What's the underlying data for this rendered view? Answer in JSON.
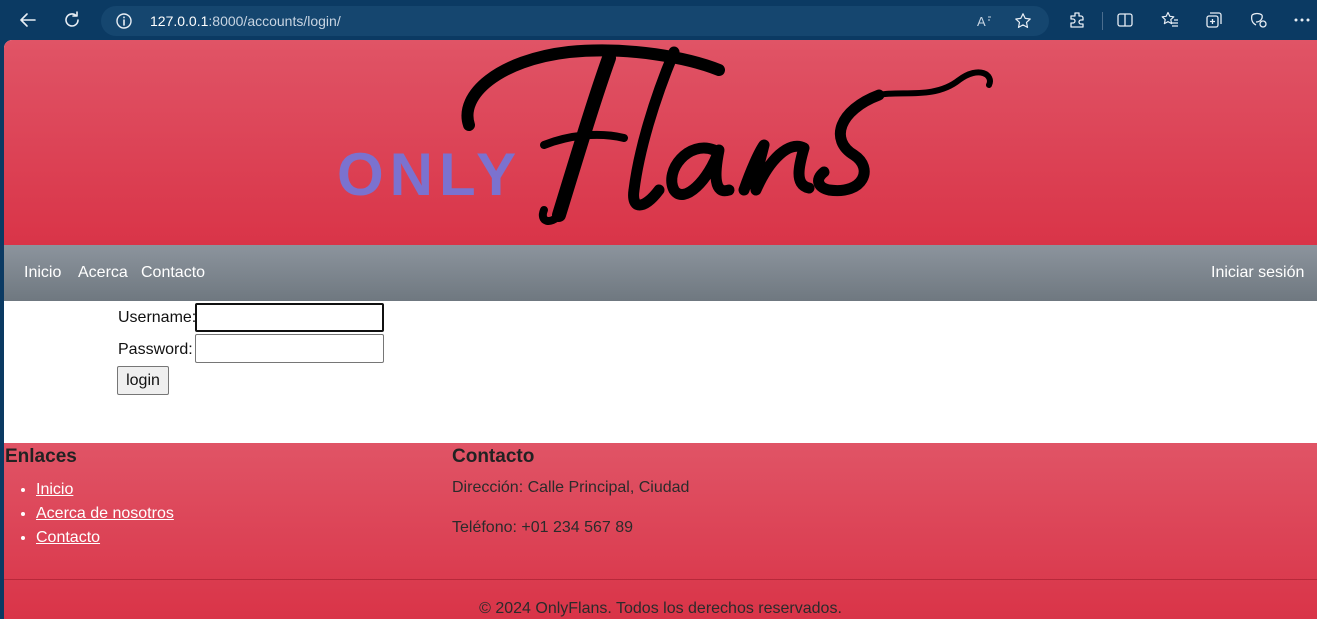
{
  "browser": {
    "url_host": "127.0.0.1",
    "url_rest": ":8000/accounts/login/",
    "icons": [
      "back-icon",
      "refresh-icon",
      "info-icon",
      "read-aloud-icon",
      "favorite-star-icon",
      "extensions-icon",
      "split-screen-icon",
      "favorites-icon",
      "collections-icon",
      "copilot-icon",
      "more-icon"
    ]
  },
  "logo": {
    "only": "ONLY",
    "flans": "Flans"
  },
  "nav": {
    "inicio": "Inicio",
    "acerca": "Acerca",
    "contacto": "Contacto",
    "login": "Iniciar sesión"
  },
  "form": {
    "username_label": "Username:",
    "username_value": "",
    "password_label": "Password:",
    "password_value": "",
    "submit": "login"
  },
  "footer": {
    "links_title": "Enlaces",
    "links": [
      "Inicio",
      "Acerca de nosotros",
      "Contacto"
    ],
    "contact_title": "Contacto",
    "address": "Dirección: Calle Principal, Ciudad",
    "phone": "Teléfono: +01 234 567 89",
    "copyright": "© 2024 OnlyFlans. Todos los derechos reservados."
  },
  "colors": {
    "hero_top": "#e05466",
    "hero_bottom": "#d93448",
    "navbar": "#7d858d",
    "logo_only": "#7b72cf",
    "browser_frame": "#0b3a63"
  }
}
